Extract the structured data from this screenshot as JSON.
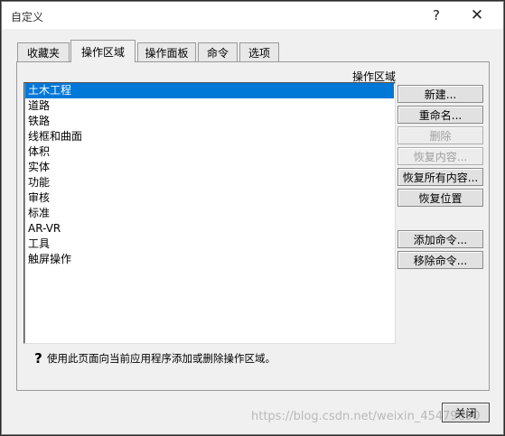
{
  "window": {
    "title": "自定义",
    "help_glyph": "?",
    "close_glyph": "✕"
  },
  "tabs": [
    {
      "label": "收藏夹",
      "active": false
    },
    {
      "label": "操作区域",
      "active": true
    },
    {
      "label": "操作面板",
      "active": false
    },
    {
      "label": "命令",
      "active": false
    },
    {
      "label": "选项",
      "active": false
    }
  ],
  "panel": {
    "section_label": "操作区域",
    "items": [
      "土木工程",
      "道路",
      "铁路",
      "线框和曲面",
      "体积",
      "实体",
      "功能",
      "审核",
      "标准",
      "AR-VR",
      "工具",
      "触屏操作"
    ],
    "selected_index": 0,
    "buttons": {
      "new": "新建...",
      "rename": "重命名...",
      "delete": "删除",
      "restore_content": "恢复内容...",
      "restore_all": "恢复所有内容...",
      "restore_position": "恢复位置",
      "add_command": "添加命令...",
      "remove_command": "移除命令..."
    },
    "hint": "使用此页面向当前应用程序添加或删除操作区域。"
  },
  "footer": {
    "close": "关闭"
  },
  "watermark": "https://blog.csdn.net/weixin_45479690"
}
